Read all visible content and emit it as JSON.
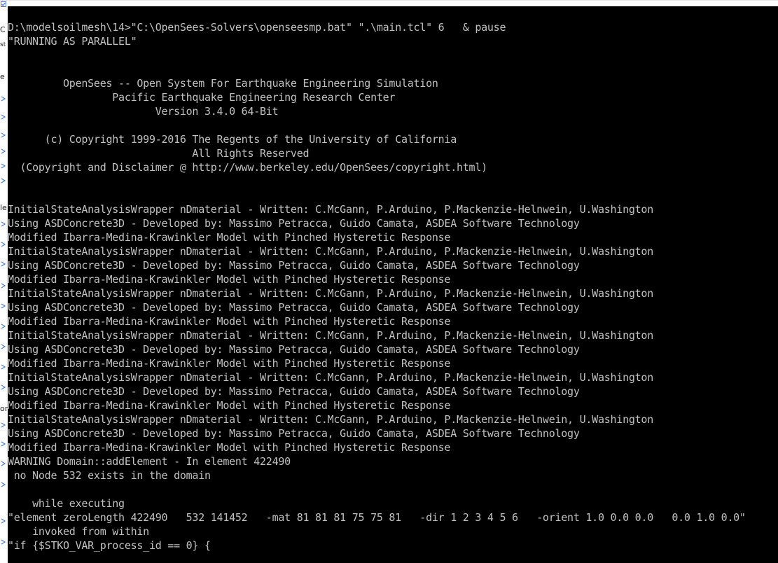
{
  "window": {
    "background": "#000000",
    "text_color": "#c0c0c0",
    "underlying_window_color": "#ffffff"
  },
  "background_window": {
    "fragments": [
      "C",
      "st",
      "e",
      "le",
      "on"
    ],
    "marks": [
      "checkbox-icon",
      "chevron-icon"
    ]
  },
  "console": {
    "lines": [
      "D:\\modelsoilmesh\\14>\"C:\\OpenSees-Solvers\\openseesmp.bat\" \".\\main.tcl\" 6   & pause",
      "\"RUNNING AS PARALLEL\"",
      "",
      "",
      "         OpenSees -- Open System For Earthquake Engineering Simulation",
      "                 Pacific Earthquake Engineering Research Center",
      "                        Version 3.4.0 64-Bit",
      "",
      "      (c) Copyright 1999-2016 The Regents of the University of California",
      "                              All Rights Reserved",
      "  (Copyright and Disclaimer @ http://www.berkeley.edu/OpenSees/copyright.html)",
      "",
      "",
      "InitialStateAnalysisWrapper nDmaterial - Written: C.McGann, P.Arduino, P.Mackenzie-Helnwein, U.Washington",
      "Using ASDConcrete3D - Developed by: Massimo Petracca, Guido Camata, ASDEA Software Technology",
      "Modified Ibarra-Medina-Krawinkler Model with Pinched Hysteretic Response",
      "InitialStateAnalysisWrapper nDmaterial - Written: C.McGann, P.Arduino, P.Mackenzie-Helnwein, U.Washington",
      "Using ASDConcrete3D - Developed by: Massimo Petracca, Guido Camata, ASDEA Software Technology",
      "Modified Ibarra-Medina-Krawinkler Model with Pinched Hysteretic Response",
      "InitialStateAnalysisWrapper nDmaterial - Written: C.McGann, P.Arduino, P.Mackenzie-Helnwein, U.Washington",
      "Using ASDConcrete3D - Developed by: Massimo Petracca, Guido Camata, ASDEA Software Technology",
      "Modified Ibarra-Medina-Krawinkler Model with Pinched Hysteretic Response",
      "InitialStateAnalysisWrapper nDmaterial - Written: C.McGann, P.Arduino, P.Mackenzie-Helnwein, U.Washington",
      "Using ASDConcrete3D - Developed by: Massimo Petracca, Guido Camata, ASDEA Software Technology",
      "Modified Ibarra-Medina-Krawinkler Model with Pinched Hysteretic Response",
      "InitialStateAnalysisWrapper nDmaterial - Written: C.McGann, P.Arduino, P.Mackenzie-Helnwein, U.Washington",
      "Using ASDConcrete3D - Developed by: Massimo Petracca, Guido Camata, ASDEA Software Technology",
      "Modified Ibarra-Medina-Krawinkler Model with Pinched Hysteretic Response",
      "InitialStateAnalysisWrapper nDmaterial - Written: C.McGann, P.Arduino, P.Mackenzie-Helnwein, U.Washington",
      "Using ASDConcrete3D - Developed by: Massimo Petracca, Guido Camata, ASDEA Software Technology",
      "Modified Ibarra-Medina-Krawinkler Model with Pinched Hysteretic Response",
      "WARNING Domain::addElement - In element 422490",
      " no Node 532 exists in the domain",
      "",
      "    while executing",
      "\"element zeroLength 422490   532 141452   -mat 81 81 81 75 75 81   -dir 1 2 3 4 5 6   -orient 1.0 0.0 0.0   0.0 1.0 0.0\"",
      "    invoked from within",
      "\"if {$STKO_VAR_process_id == 0} {"
    ]
  }
}
